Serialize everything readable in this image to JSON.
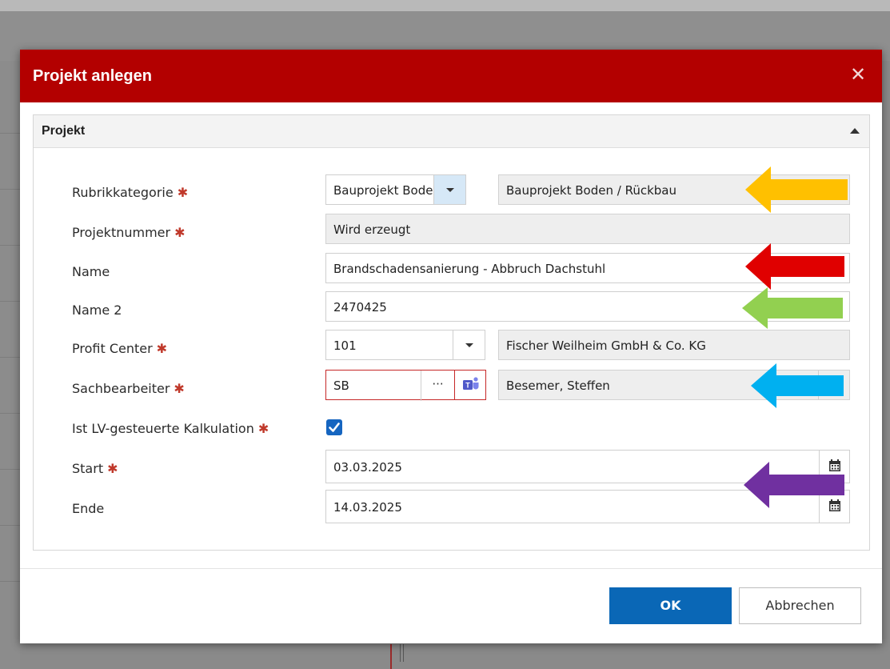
{
  "dialog": {
    "title": "Projekt anlegen",
    "close_icon": "close-icon"
  },
  "section": {
    "title": "Projekt",
    "collapse_icon": "chevron-up-icon"
  },
  "form": {
    "rubrikkategorie": {
      "label": "Rubrikkategorie",
      "value": "Bauprojekt Boden",
      "description": "Bauprojekt Boden / Rückbau"
    },
    "projektnummer": {
      "label": "Projektnummer",
      "value": "Wird erzeugt"
    },
    "name": {
      "label": "Name",
      "value": "Brandschadensanierung - Abbruch Dachstuhl"
    },
    "name2": {
      "label": "Name 2",
      "value": "2470425"
    },
    "profit_center": {
      "label": "Profit Center",
      "value": "101",
      "description": "Fischer Weilheim GmbH & Co. KG"
    },
    "sachbearbeiter": {
      "label": "Sachbearbeiter",
      "value": "SB",
      "more": "···",
      "description": "Besemer, Steffen"
    },
    "lv_kalkulation": {
      "label": "Ist LV-gesteuerte Kalkulation",
      "checked": true
    },
    "start": {
      "label": "Start",
      "value": "03.03.2025"
    },
    "ende": {
      "label": "Ende",
      "value": "14.03.2025"
    },
    "required_marker": "✱"
  },
  "buttons": {
    "ok": "OK",
    "cancel": "Abbrechen"
  },
  "colors": {
    "titlebar": "#b30000",
    "ok_button": "#0a67b6",
    "arrow_rubrik": "#ffc000",
    "arrow_name": "#e00000",
    "arrow_name2": "#92d050",
    "arrow_sachbearbeiter": "#00b0f0",
    "arrow_dates": "#7030a0"
  }
}
